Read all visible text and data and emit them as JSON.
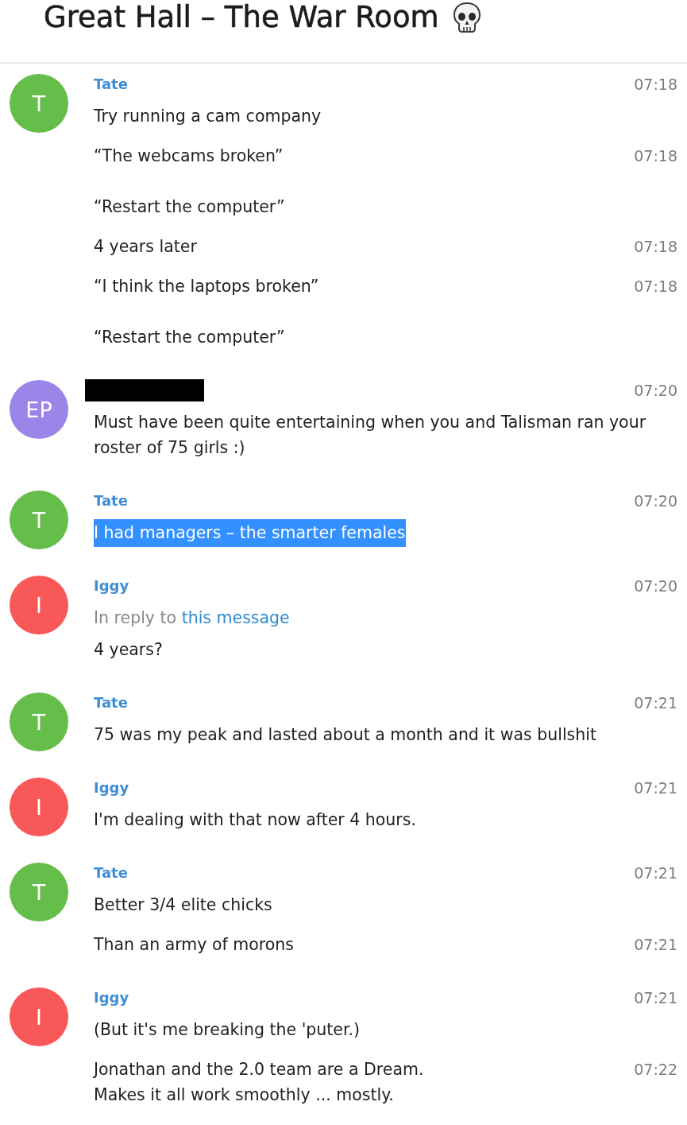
{
  "header": {
    "title": "Great Hall – The War Room"
  },
  "groups": [
    {
      "avatar_letter": "T",
      "color": "#65bd4a",
      "name": "Tate",
      "redacted": false,
      "time": "07:18",
      "messages": [
        {
          "paragraphs": [
            "Try running a cam company"
          ],
          "highlighted": false
        },
        {
          "time": "07:18",
          "paragraphs": [
            "“The webcams broken”",
            "“Restart the computer”"
          ],
          "highlighted": false
        },
        {
          "time": "07:18",
          "paragraphs": [
            "4 years later"
          ],
          "highlighted": false
        },
        {
          "time": "07:18",
          "paragraphs": [
            "“I think the laptops broken”",
            "“Restart the computer”"
          ],
          "highlighted": false
        }
      ]
    },
    {
      "avatar_letter": "EP",
      "color": "#9a86e8",
      "redacted": true,
      "time": "07:20",
      "messages": [
        {
          "paragraphs": [
            "Must have been quite entertaining when you and Talisman ran your roster of 75 girls :)"
          ],
          "highlighted": false
        }
      ]
    },
    {
      "avatar_letter": "T",
      "color": "#65bd4a",
      "name": "Tate",
      "redacted": false,
      "time": "07:20",
      "messages": [
        {
          "paragraphs": [
            "I had managers – the smarter females"
          ],
          "highlighted": true
        }
      ]
    },
    {
      "avatar_letter": "I",
      "color": "#f95858",
      "name": "Iggy",
      "redacted": false,
      "time": "07:20",
      "messages": [
        {
          "reply": {
            "text": "In reply to",
            "link": "this message"
          },
          "paragraphs": [
            "4 years?"
          ],
          "highlighted": false
        }
      ]
    },
    {
      "avatar_letter": "T",
      "color": "#65bd4a",
      "name": "Tate",
      "redacted": false,
      "time": "07:21",
      "messages": [
        {
          "paragraphs": [
            "75 was my peak and lasted about a month and it was bullshit"
          ],
          "highlighted": false
        }
      ]
    },
    {
      "avatar_letter": "I",
      "color": "#f95858",
      "name": "Iggy",
      "redacted": false,
      "time": "07:21",
      "messages": [
        {
          "paragraphs": [
            "I'm dealing with that now after 4 hours."
          ],
          "highlighted": false
        }
      ]
    },
    {
      "avatar_letter": "T",
      "color": "#65bd4a",
      "name": "Tate",
      "redacted": false,
      "time": "07:21",
      "messages": [
        {
          "paragraphs": [
            "Better 3/4 elite chicks"
          ],
          "highlighted": false
        },
        {
          "time": "07:21",
          "paragraphs": [
            "Than an army of morons"
          ],
          "highlighted": false
        }
      ]
    },
    {
      "avatar_letter": "I",
      "color": "#f95858",
      "name": "Iggy",
      "redacted": false,
      "time": "07:21",
      "messages": [
        {
          "paragraphs": [
            "(But it's me breaking the 'puter.)"
          ],
          "highlighted": false
        },
        {
          "time": "07:22",
          "paragraphs": [
            "Jonathan and the 2.0 team are a Dream.\nMakes it all work smoothly ... mostly."
          ],
          "highlighted": false
        }
      ]
    }
  ]
}
